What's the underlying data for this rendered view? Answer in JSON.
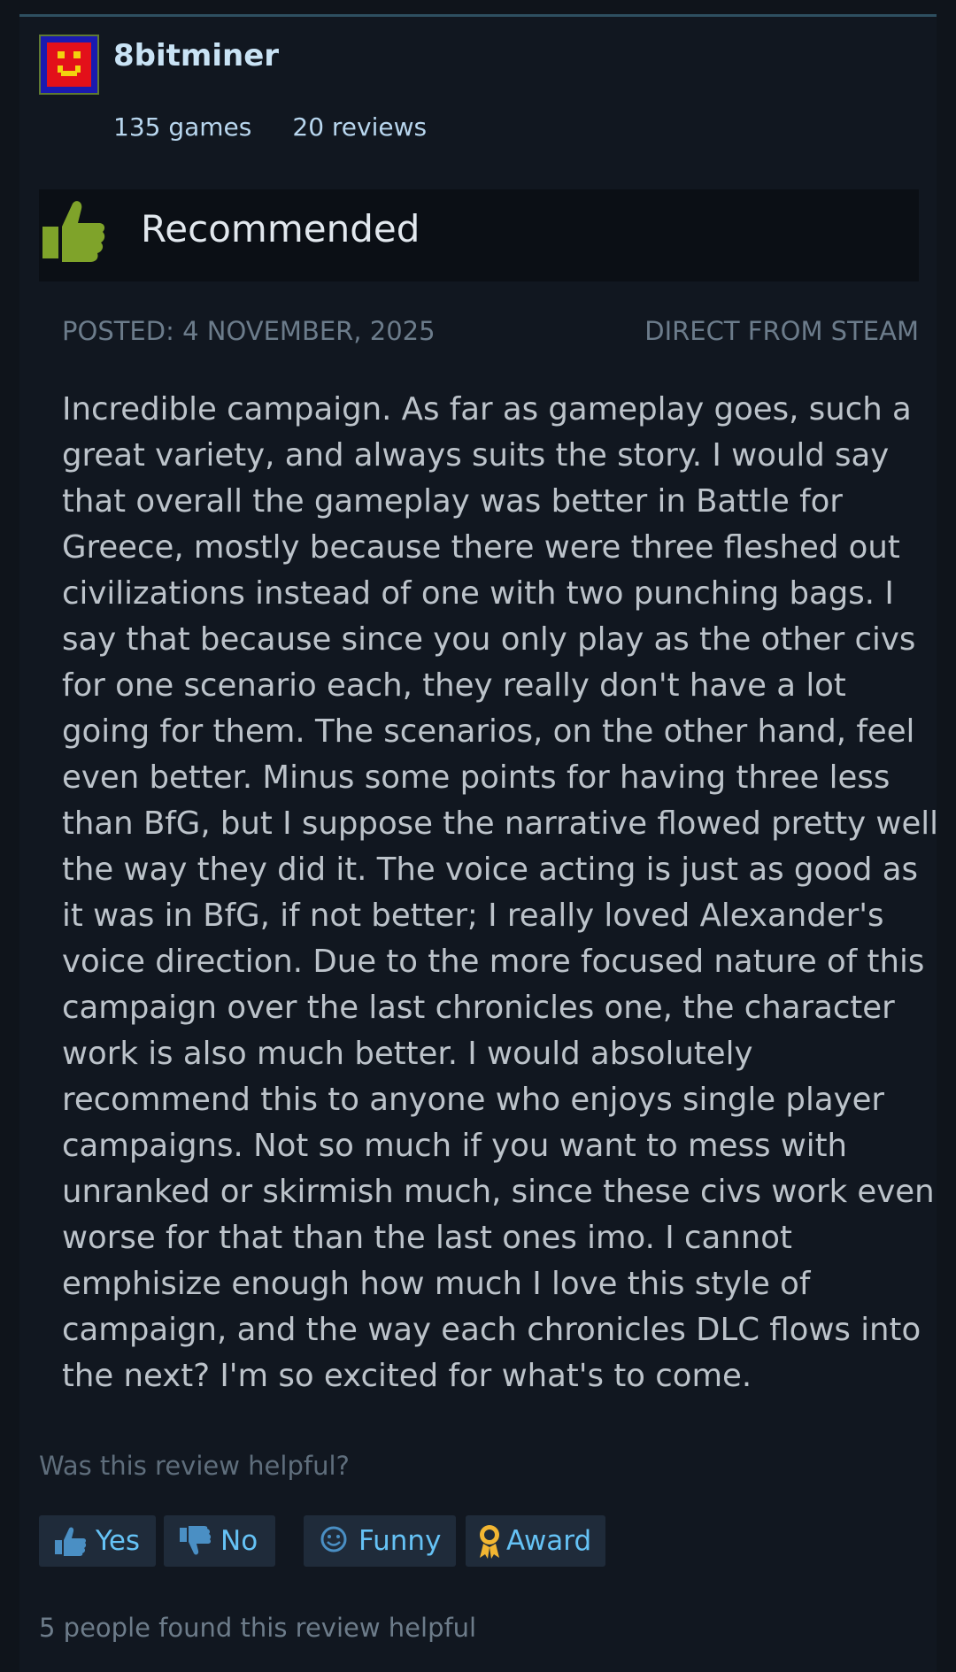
{
  "author": {
    "name": "8bitminer",
    "games": "135 games",
    "reviews": "20 reviews"
  },
  "verdict": {
    "label": "Recommended",
    "icon": "thumbs-up-icon"
  },
  "meta": {
    "posted": "POSTED: 4 NOVEMBER, 2025",
    "source": "DIRECT FROM STEAM"
  },
  "review": {
    "text": "Incredible campaign. As far as gameplay goes, such a great variety, and always suits the story. I would say that overall the gameplay was better in Battle for Greece, mostly because there were three fleshed out civilizations instead of one with two punching bags. I say that because since you only play as the other civs for one scenario each, they really don't have a lot going for them. The scenarios, on the other hand, feel even better. Minus some points for having three less than BfG, but I suppose the narrative flowed pretty well the way they did it. The voice acting is just as good as it was in BfG, if not better; I really loved Alexander's voice direction. Due to the more focused nature of this campaign over the last chronicles one, the character work is also much better. I would absolutely recommend this to anyone who enjoys single player campaigns. Not so much if you want to mess with unranked or skirmish much, since these civs work even worse for that than the last ones imo. I cannot emphisize enough how much I love this style of campaign, and the way each chronicles DLC flows into the next? I'm so excited for what's to come."
  },
  "helpful": {
    "question": "Was this review helpful?",
    "yes": "Yes",
    "no": "No",
    "funny": "Funny",
    "award": "Award",
    "count_text": "5 people found this review helpful"
  },
  "colors": {
    "background": "#111720",
    "accent": "#65c2f5",
    "thumb": "#7fa32a",
    "award": "#f2b632"
  }
}
